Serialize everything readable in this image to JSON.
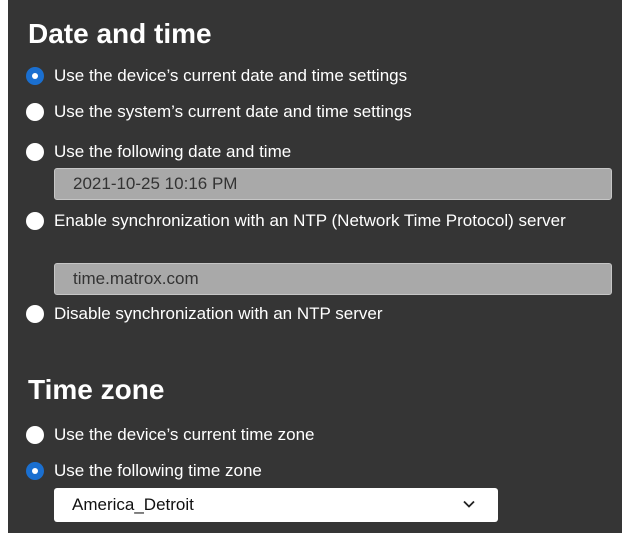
{
  "date_time": {
    "heading": "Date and time",
    "options": [
      {
        "label": "Use the device’s current date and time settings",
        "checked": true
      },
      {
        "label": "Use the system’s current date and time settings",
        "checked": false
      },
      {
        "label": "Use the following date and time",
        "checked": false
      },
      {
        "label": "Enable synchronization with an NTP (Network Time Protocol) server",
        "checked": false
      },
      {
        "label": "Disable synchronization with an NTP server",
        "checked": false
      }
    ],
    "date_value": "2021-10-25 10:16  PM",
    "ntp_value": "time.matrox.com"
  },
  "time_zone": {
    "heading": "Time zone",
    "options": [
      {
        "label": "Use the device’s current time zone",
        "checked": false
      },
      {
        "label": "Use the following time zone",
        "checked": true
      }
    ],
    "selected_zone": "America_Detroit"
  },
  "icons": {
    "radio_checked": "radio-selected",
    "radio_unchecked": "radio-unselected",
    "dropdown": "chevron-down-icon"
  },
  "colors": {
    "panel_bg": "#353535",
    "accent": "#1a6fd0",
    "disabled_field": "#a9a9a9"
  }
}
